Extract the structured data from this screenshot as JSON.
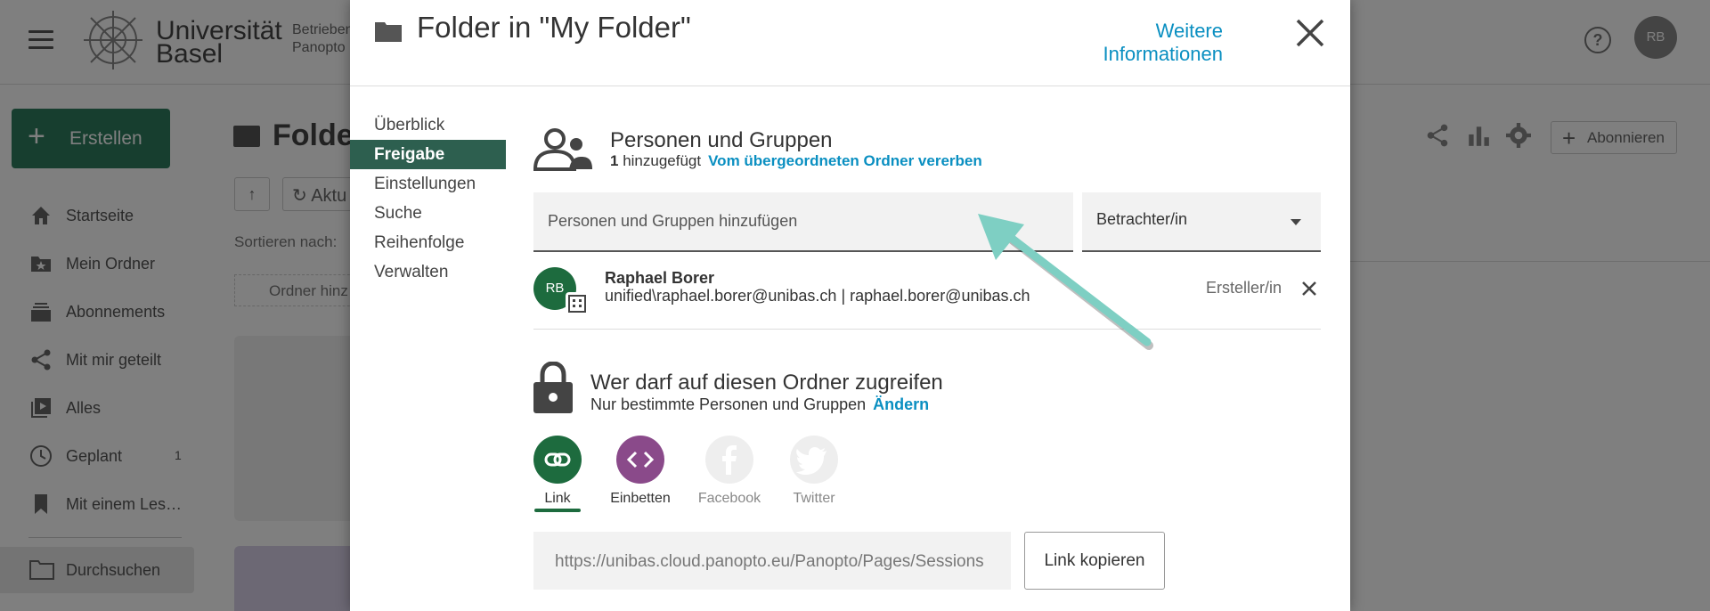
{
  "topbar": {
    "logo_line1": "Universität",
    "logo_line2": "Basel",
    "operated_line1": "Betrieben",
    "operated_line2": "Panopto",
    "avatar_initials": "RB"
  },
  "sidebar": {
    "create_label": "Erstellen",
    "items": [
      {
        "label": "Startseite",
        "icon": "home-icon"
      },
      {
        "label": "Mein Ordner",
        "icon": "star-folder-icon"
      },
      {
        "label": "Abonnements",
        "icon": "subscriptions-icon"
      },
      {
        "label": "Mit mir geteilt",
        "icon": "share-icon"
      },
      {
        "label": "Alles",
        "icon": "play-library-icon"
      },
      {
        "label": "Geplant",
        "icon": "clock-icon",
        "count": "1"
      },
      {
        "label": "Mit einem Les…",
        "icon": "bookmark-icon"
      }
    ],
    "browse_label": "Durchsuchen"
  },
  "main": {
    "title": "Folde",
    "refresh_label": "Aktu",
    "sort_label": "Sortieren nach:",
    "add_folder_label": "Ordner hinz",
    "subscribe_label": "Abonnieren"
  },
  "modal": {
    "title": "Folder in \"My Folder\"",
    "more_info": "Weitere Informationen",
    "tabs": [
      {
        "label": "Überblick",
        "active": false
      },
      {
        "label": "Freigabe",
        "active": true
      },
      {
        "label": "Einstellungen",
        "active": false
      },
      {
        "label": "Suche",
        "active": false
      },
      {
        "label": "Reihenfolge",
        "active": false
      },
      {
        "label": "Verwalten",
        "active": false
      }
    ],
    "people": {
      "title": "Personen und Gruppen",
      "count": "1",
      "added_label": "hinzugefügt",
      "inherit_link": "Vom übergeordneten Ordner vererben",
      "input_placeholder": "Personen und Gruppen hinzufügen",
      "role_selected": "Betrachter/in"
    },
    "member": {
      "initials": "RB",
      "name": "Raphael Borer",
      "email": "unified\\raphael.borer@unibas.ch | raphael.borer@unibas.ch",
      "role": "Ersteller/in"
    },
    "access": {
      "title": "Wer darf auf diesen Ordner zugreifen",
      "subtitle": "Nur bestimmte Personen und Gruppen",
      "change_link": "Ändern"
    },
    "share_options": [
      {
        "label": "Link",
        "icon": "link-icon",
        "color": "#1d6b3e",
        "active": true
      },
      {
        "label": "Einbetten",
        "icon": "embed-icon",
        "color": "#8a4a8a",
        "active": false
      },
      {
        "label": "Facebook",
        "icon": "facebook-icon",
        "color": "#eeeeee",
        "active": false
      },
      {
        "label": "Twitter",
        "icon": "twitter-icon",
        "color": "#eeeeee",
        "active": false
      }
    ],
    "link_url": "https://unibas.cloud.panopto.eu/Panopto/Pages/Sessions",
    "copy_button": "Link kopieren"
  },
  "colors": {
    "accent_green": "#2d5f4f",
    "link_blue": "#0a8fc1",
    "annotation_arrow": "#7ecfc3"
  }
}
